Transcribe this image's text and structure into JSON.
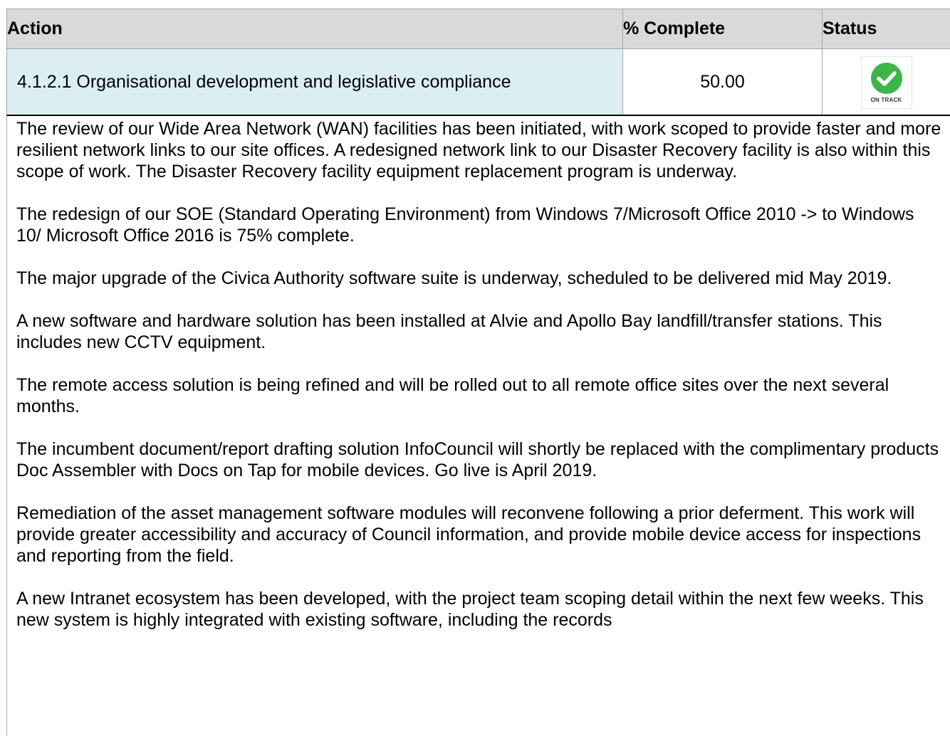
{
  "table": {
    "headers": {
      "action": "Action",
      "percent_complete": "% Complete",
      "status": "Status"
    },
    "row": {
      "action": "4.1.2.1 Organisational development and legislative compliance",
      "percent_complete": "50.00",
      "status_label": "ON TRACK",
      "status_icon": "check-circle-icon",
      "status_color": "#3cb649"
    }
  },
  "colors": {
    "header_bg": "#d9d9d9",
    "action_cell_bg": "#dbeef4",
    "border": "#a6a6a6"
  },
  "paragraphs": [
    "The review of our Wide Area Network (WAN) facilities has been initiated, with work scoped to provide faster and more resilient network links to our site offices. A redesigned network link to our Disaster Recovery facility is also within this scope of work. The Disaster Recovery facility equipment replacement program is underway.",
    "The redesign of our SOE (Standard Operating Environment) from Windows 7/Microsoft Office 2010 -> to Windows 10/ Microsoft Office 2016 is 75% complete.",
    "The major upgrade of the Civica Authority software suite is underway, scheduled to be delivered mid May 2019.",
    "A new software and hardware solution has been installed at Alvie and Apollo Bay landfill/transfer stations. This includes new CCTV equipment.",
    "The remote access solution is being refined and will be rolled out to all remote office sites over the next several months.",
    "The incumbent document/report drafting solution InfoCouncil will shortly be replaced with the complimentary products Doc Assembler with Docs on Tap for mobile devices. Go live is April 2019.",
    "Remediation of the asset management software modules will reconvene following a prior deferment. This work will provide greater accessibility and accuracy of Council information, and provide mobile device access for inspections and reporting from the field.",
    "A new Intranet ecosystem has been developed, with the project team scoping detail within the next few weeks. This new system is highly integrated with existing software, including the records"
  ]
}
